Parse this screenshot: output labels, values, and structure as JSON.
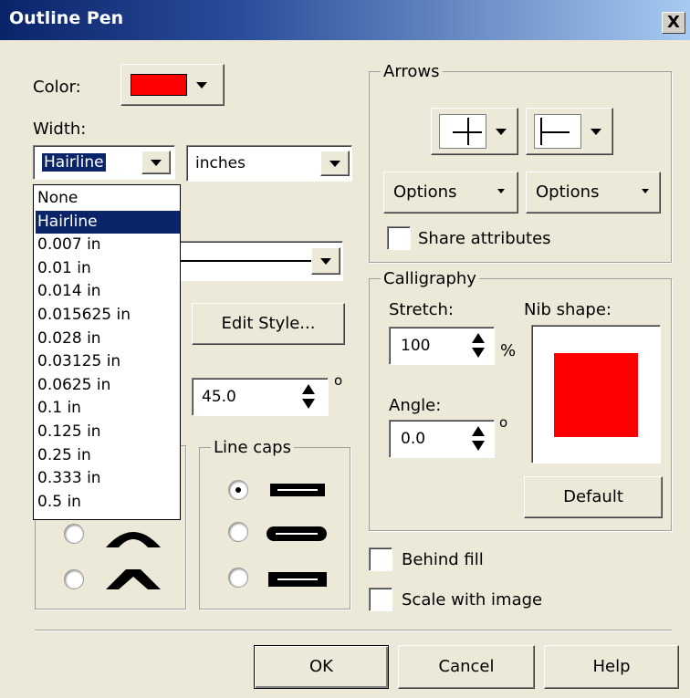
{
  "dialog": {
    "title": "Outline Pen",
    "close_label": "X"
  },
  "color": {
    "label": "Color:",
    "swatch": "#ff0000"
  },
  "width": {
    "label": "Width:",
    "value": "Hairline",
    "options": [
      "None",
      "Hairline",
      "0.007 in",
      "0.01 in",
      "0.014 in",
      "0.015625 in",
      "0.028 in",
      "0.03125 in",
      "0.0625 in",
      "0.1 in",
      "0.125 in",
      "0.25 in",
      "0.333 in",
      "0.5 in"
    ],
    "selected_index": 1
  },
  "units": {
    "value": "inches"
  },
  "edit_style": {
    "label": "Edit Style..."
  },
  "angle_field": {
    "value": "45.0",
    "unit": "o"
  },
  "line_caps": {
    "legend": "Line caps"
  },
  "arrows": {
    "legend": "Arrows",
    "options_left": "Options",
    "options_right": "Options",
    "share_label": "Share attributes"
  },
  "calligraphy": {
    "legend": "Calligraphy",
    "stretch_label": "Stretch:",
    "stretch_value": "100",
    "stretch_unit": "%",
    "angle_label": "Angle:",
    "angle_value": "0.0",
    "angle_unit": "o",
    "nib_label": "Nib shape:",
    "default_label": "Default"
  },
  "behind_fill": {
    "label": "Behind fill"
  },
  "scale_with_image": {
    "label": "Scale with image"
  },
  "buttons": {
    "ok": "OK",
    "cancel": "Cancel",
    "help": "Help"
  }
}
